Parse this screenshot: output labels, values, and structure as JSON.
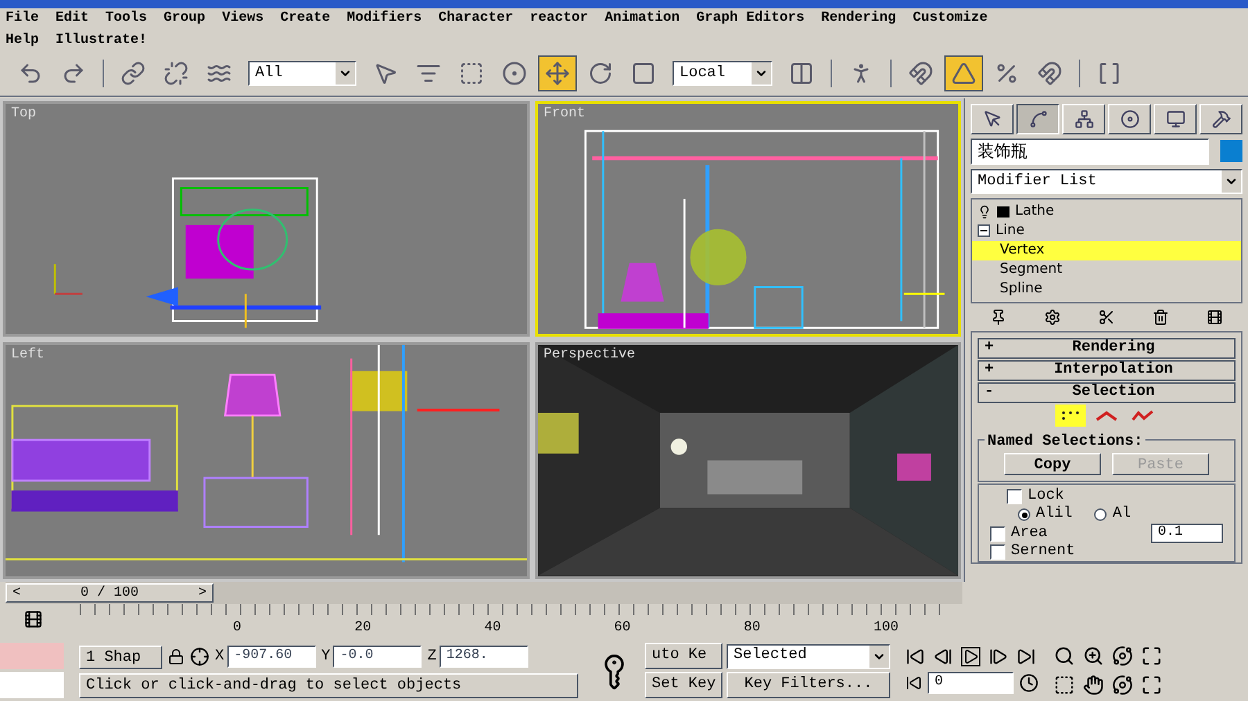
{
  "menu_rows": [
    [
      "File",
      "Edit",
      "Tools",
      "Group",
      "Views",
      "Create",
      "Modifiers",
      "Character",
      "reactor",
      "Animation",
      "Graph Editors",
      "Rendering",
      "Customize"
    ],
    [
      "Help",
      "Illustrate!"
    ]
  ],
  "toolbar": [
    {
      "kind": "button",
      "active": false
    },
    {
      "kind": "button",
      "active": false
    },
    {
      "kind": "sep"
    },
    {
      "kind": "button",
      "active": false
    },
    {
      "kind": "button",
      "active": false
    },
    {
      "kind": "button",
      "active": false
    },
    {
      "kind": "dropdown",
      "value": "All"
    },
    {
      "kind": "button",
      "active": false
    },
    {
      "kind": "button",
      "active": false
    },
    {
      "kind": "button",
      "active": false
    },
    {
      "kind": "button",
      "active": false
    },
    {
      "kind": "button",
      "active": true
    },
    {
      "kind": "button",
      "active": false
    },
    {
      "kind": "button",
      "active": false
    },
    {
      "kind": "dropdown",
      "value": "Local"
    },
    {
      "kind": "button",
      "active": false
    },
    {
      "kind": "sep"
    },
    {
      "kind": "button",
      "active": false
    },
    {
      "kind": "sep"
    },
    {
      "kind": "button",
      "active": false
    },
    {
      "kind": "button",
      "active": true
    },
    {
      "kind": "button",
      "active": false
    },
    {
      "kind": "button",
      "active": false
    },
    {
      "kind": "sep"
    },
    {
      "kind": "button",
      "active": false
    }
  ],
  "viewports": [
    {
      "label": "Top",
      "active": false,
      "kind": "wireframe"
    },
    {
      "label": "Front",
      "active": true,
      "kind": "wireframe"
    },
    {
      "label": "Left",
      "active": false,
      "kind": "wireframe"
    },
    {
      "label": "Perspective",
      "active": false,
      "kind": "render"
    }
  ],
  "command_panel": {
    "tabs": [
      {
        "selected": false
      },
      {
        "selected": true
      },
      {
        "selected": false
      },
      {
        "selected": false
      },
      {
        "selected": false
      },
      {
        "selected": false
      }
    ],
    "object_name": "装饰瓶",
    "modifier_list": "Modifier List",
    "stack": [
      {
        "label": "Lathe",
        "selected": false
      },
      {
        "label": "Line",
        "selected": false,
        "expanded": true,
        "children": [
          {
            "label": "Vertex",
            "selected": true
          },
          {
            "label": "Segment",
            "selected": false
          },
          {
            "label": "Spline",
            "selected": false
          }
        ]
      }
    ],
    "rollouts": [
      {
        "toggle": "+",
        "title": "Rendering"
      },
      {
        "toggle": "+",
        "title": "Interpolation"
      },
      {
        "toggle": "-",
        "title": "Selection"
      }
    ],
    "selection": {
      "levels": [
        {
          "selected": true
        },
        {
          "selected": false
        },
        {
          "selected": false
        }
      ],
      "named_selections": "Named Selections:",
      "copy": {
        "label": "Copy",
        "disabled": false
      },
      "paste": {
        "label": "Paste",
        "disabled": true
      },
      "lock": {
        "label": "Lock",
        "checked": false
      },
      "radios": [
        {
          "label": "Alil",
          "selected": true
        },
        {
          "label": "Al",
          "selected": false
        }
      ],
      "area": {
        "label": "Area",
        "checked": false,
        "value": "0.1"
      },
      "segment": {
        "label": "Sernent",
        "checked": false
      }
    }
  },
  "time_slider": {
    "prev": "<",
    "label": "0 / 100",
    "next": ">",
    "level": 0
  },
  "track_bar": {
    "labels": [
      "0",
      "20",
      "40",
      "60",
      "80",
      "100"
    ]
  },
  "status": {
    "selection_count": "1 Shap",
    "coords": [
      {
        "axis": "X",
        "value": "-907.60"
      },
      {
        "axis": "Y",
        "value": "-0.0"
      },
      {
        "axis": "Z",
        "value": "1268."
      }
    ],
    "prompt": "Click or click-and-drag to select objects"
  },
  "animation": {
    "auto_key": {
      "label": "uto Ke",
      "on": false
    },
    "set_key": "Set Key",
    "key_mode": "Selected",
    "key_filters": "Key Filters...",
    "frame": "0"
  }
}
